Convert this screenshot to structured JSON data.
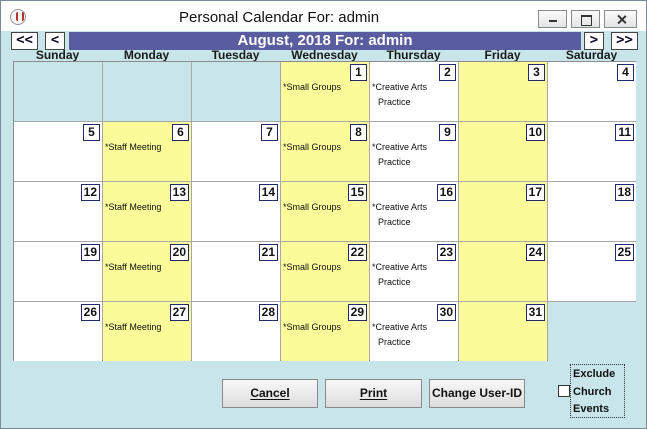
{
  "window": {
    "title": "Personal Calendar For: admin"
  },
  "nav": {
    "prev_year": "<<",
    "prev_month": "<",
    "banner": "August, 2018 For: admin",
    "next_month": ">",
    "next_year": ">>"
  },
  "day_headers": [
    "Sunday",
    "Monday",
    "Tuesday",
    "Wednesday",
    "Thursday",
    "Friday",
    "Saturday"
  ],
  "events": {
    "monday": "*Staff Meeting",
    "wednesday": "*Small Groups",
    "thursday_1": "*Creative Arts",
    "thursday_2": "Practice"
  },
  "weeks": [
    [
      null,
      null,
      null,
      1,
      2,
      3,
      4
    ],
    [
      5,
      6,
      7,
      8,
      9,
      10,
      11
    ],
    [
      12,
      13,
      14,
      15,
      16,
      17,
      18
    ],
    [
      19,
      20,
      21,
      22,
      23,
      24,
      25
    ],
    [
      26,
      27,
      28,
      29,
      30,
      31,
      null
    ]
  ],
  "colors": {
    "event_day": "#fbfb9a",
    "banner": "#5a5ca0",
    "background": "#c8e6ea"
  },
  "buttons": {
    "cancel": "Cancel",
    "print": "Print",
    "change_user": "Change User-ID"
  },
  "exclude": {
    "line1": "Exclude",
    "line2": "Church",
    "line3": "Events",
    "checked": false
  }
}
